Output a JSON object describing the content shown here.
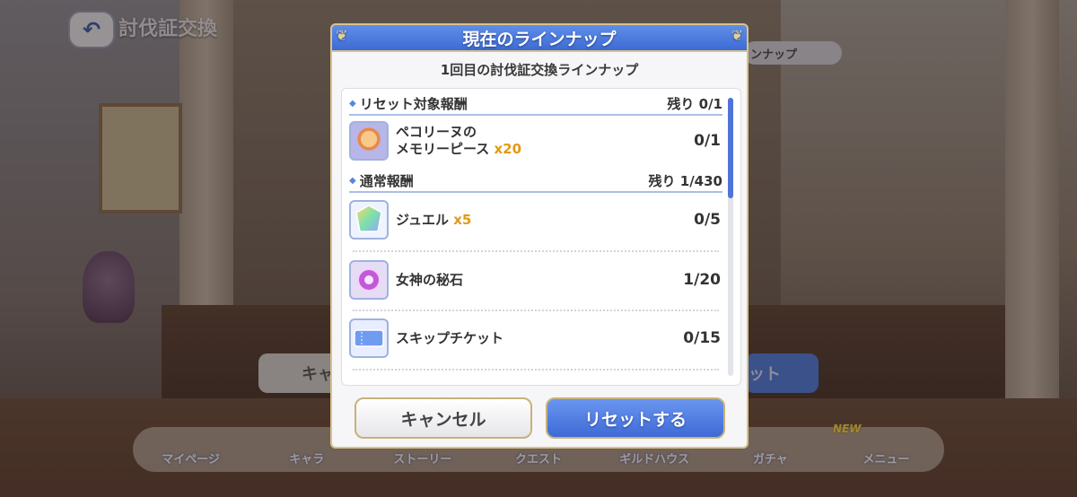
{
  "screen": {
    "back_icon": "back-arrow-icon",
    "title": "討伐証交換",
    "lineup_pill": "ンナップ",
    "bg_cancel": "キャ",
    "bg_reset": "ット"
  },
  "bottom_nav": {
    "new_badge": "NEW",
    "items": [
      "マイページ",
      "キャラ",
      "ストーリー",
      "クエスト",
      "ギルドハウス",
      "ガチャ",
      "メニュー"
    ]
  },
  "dialog": {
    "title": "現在のラインナップ",
    "subtitle": "1回目の討伐証交換ラインナップ",
    "sections": [
      {
        "label": "リセット対象報酬",
        "remaining": "残り 0/1",
        "items": [
          {
            "icon": "memory-piece-icon",
            "name_line1": "ペコリーヌの",
            "name_line2": "メモリーピース",
            "qty": "x20",
            "count": "0/1"
          }
        ]
      },
      {
        "label": "通常報酬",
        "remaining": "残り 1/430",
        "items": [
          {
            "icon": "jewel-icon",
            "name": "ジュエル",
            "qty": "x5",
            "count": "0/5"
          },
          {
            "icon": "goddess-stone-icon",
            "name": "女神の秘石",
            "count": "1/20"
          },
          {
            "icon": "skip-ticket-icon",
            "name": "スキップチケット",
            "count": "0/15"
          }
        ]
      }
    ],
    "cancel_label": "キャンセル",
    "reset_label": "リセットする"
  },
  "colors": {
    "accent_blue": "#3d6bd4",
    "qty_orange": "#e29a12",
    "gold_border": "#d8c38a"
  }
}
